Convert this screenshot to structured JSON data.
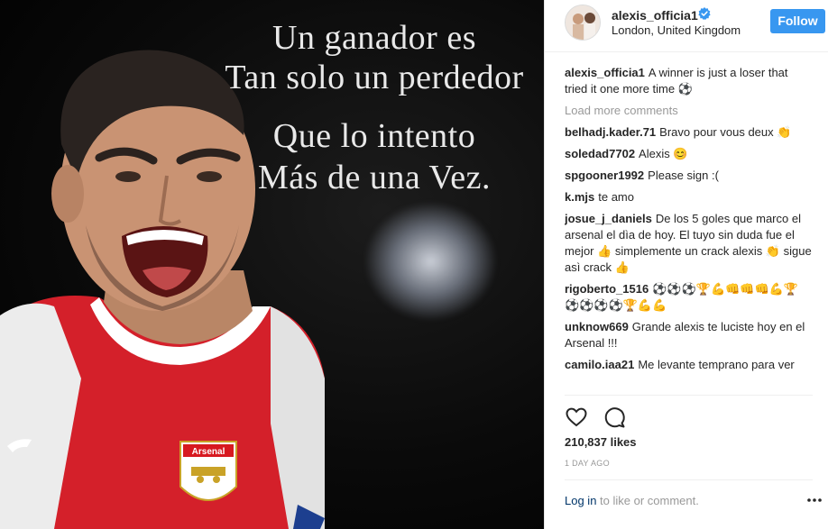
{
  "post": {
    "quote_lines": [
      "Un   ganador es",
      "Tan solo un perdedor",
      "Que lo intento",
      "Más de una Vez."
    ],
    "jersey_brand": "Arsenal"
  },
  "header": {
    "username": "alexis_officia1",
    "location": "London, United Kingdom",
    "follow_label": "Follow",
    "verified_icon": "verified-badge-icon"
  },
  "caption": {
    "author": "alexis_officia1",
    "text": "A winner is just a loser that tried it one more time ⚽"
  },
  "load_more": "Load more comments",
  "comments": [
    {
      "author": "belhadj.kader.71",
      "text": "Bravo pour vous deux 👏"
    },
    {
      "author": "soledad7702",
      "text": "Alexis 😊"
    },
    {
      "author": "spgooner1992",
      "text": "Please sign :("
    },
    {
      "author": "k.mjs",
      "text": "te amo"
    },
    {
      "author": "josue_j_daniels",
      "text": "De los 5 goles que marco el arsenal el dìa de hoy. El tuyo sin duda fue el mejor 👍 simplemente un crack alexis 👏 sigue asì crack 👍"
    },
    {
      "author": "rigoberto_1516",
      "text": "⚽⚽⚽🏆💪👊👊👊💪🏆⚽⚽⚽⚽🏆💪💪"
    },
    {
      "author": "unknow669",
      "text": "Grande alexis te luciste hoy en el Arsenal !!!"
    },
    {
      "author": "camilo.iaa21",
      "text": "Me levante temprano para ver"
    }
  ],
  "actions": {
    "like_icon": "heart-icon",
    "comment_icon": "comment-icon"
  },
  "likes": "210,837 likes",
  "time_ago": "1 DAY AGO",
  "login": {
    "link": "Log in",
    "rest": " to like or comment."
  },
  "colors": {
    "follow_blue": "#3897f0",
    "jersey_red": "#d71920",
    "verified_blue": "#3897f0"
  }
}
